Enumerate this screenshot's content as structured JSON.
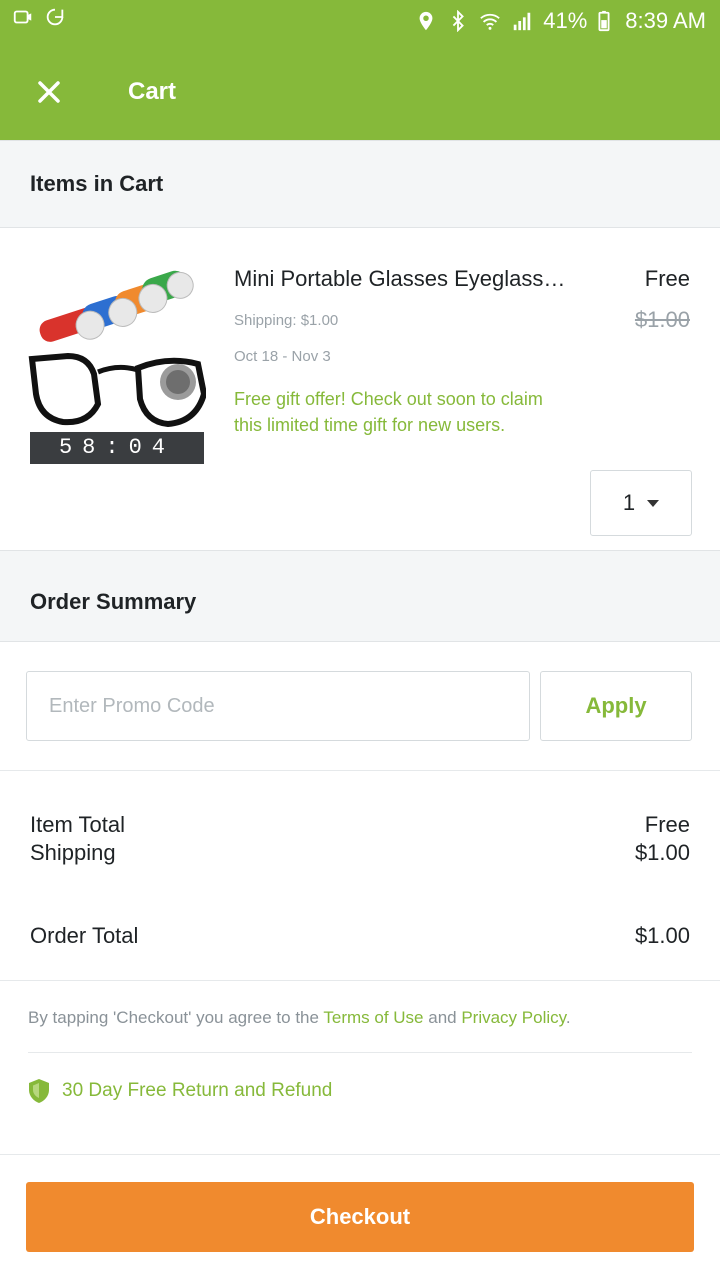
{
  "status_bar": {
    "battery": "41%",
    "time": "8:39 AM",
    "icons": [
      "location-icon",
      "bluetooth-icon",
      "wifi-icon",
      "signal-icon",
      "battery-icon"
    ]
  },
  "header": {
    "close_icon": "close-icon",
    "title": "Cart"
  },
  "cart_section": {
    "heading": "Items in Cart"
  },
  "item": {
    "title": "Mini Portable Glasses Eyeglasses Cleaner",
    "price": "Free",
    "original_price": "$1.00",
    "shipping": "Shipping: $1.00",
    "delivery": "Oct 18 - Nov 3",
    "gift_offer": "Free gift offer! Check out soon to claim this limited time gift for new users.",
    "timer": "58:04",
    "quantity": "1"
  },
  "order_summary": {
    "heading": "Order Summary",
    "promo_placeholder": "Enter Promo Code",
    "apply_label": "Apply",
    "rows": [
      {
        "label": "Item Total",
        "value": "Free"
      },
      {
        "label": "Shipping",
        "value": "$1.00"
      },
      {
        "label": "Order Total",
        "value": "$1.00"
      }
    ]
  },
  "terms": {
    "prefix": "By tapping 'Checkout' you agree to the ",
    "terms_link": "Terms of Use",
    "and": " and ",
    "privacy_link": "Privacy Policy",
    "suffix": "."
  },
  "refund": {
    "icon": "shield-icon",
    "label": "30 Day Free Return and Refund"
  },
  "checkout": {
    "label": "Checkout"
  },
  "colors": {
    "brand_green": "#86b93a",
    "checkout_orange": "#f08a2e",
    "section_bg": "#f4f6f7"
  }
}
